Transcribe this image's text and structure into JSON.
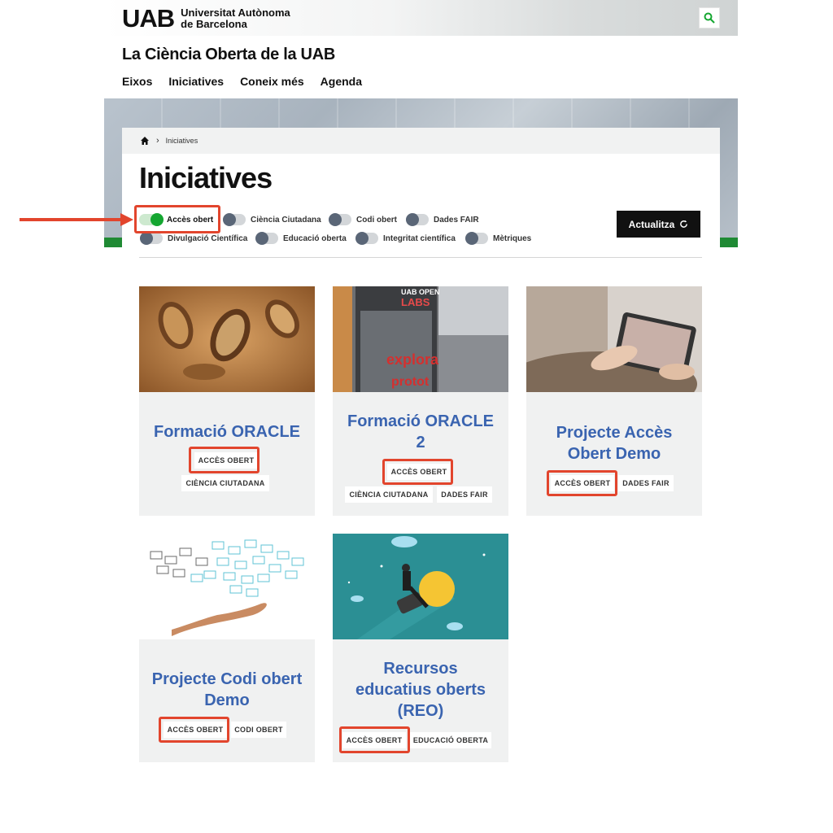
{
  "header": {
    "logo_mark": "UAB",
    "logo_line1": "Universitat Autònoma",
    "logo_line2": "de Barcelona",
    "site_title": "La Ciència Oberta de la UAB",
    "nav": [
      "Eixos",
      "Iniciatives",
      "Coneix més",
      "Agenda"
    ]
  },
  "breadcrumb": {
    "current": "Iniciatives"
  },
  "page_title": "Iniciatives",
  "filters": [
    {
      "label": "Accès obert",
      "on": true
    },
    {
      "label": "Ciència Ciutadana",
      "on": false
    },
    {
      "label": "Codi obert",
      "on": false
    },
    {
      "label": "Dades FAIR",
      "on": false
    },
    {
      "label": "Divulgació Científica",
      "on": false
    },
    {
      "label": "Educació oberta",
      "on": false
    },
    {
      "label": "Integritat científica",
      "on": false
    },
    {
      "label": "Mètriques",
      "on": false
    }
  ],
  "update_button": "Actualitza",
  "cards": [
    {
      "title_lines": [
        "Formació ORACLE"
      ],
      "tags": [
        "ACCÈS OBERT",
        "CIÈNCIA CIUTADANA"
      ],
      "image": "fossils-photo"
    },
    {
      "title_lines": [
        "Formació ORACLE",
        "2"
      ],
      "tags": [
        "ACCÈS OBERT",
        "CIÈNCIA CIUTADANA",
        "DADES FAIR"
      ],
      "image": "open-labs-photo",
      "image_text": [
        "UAB OPEN",
        "LABS",
        "explora",
        "protot"
      ]
    },
    {
      "title_lines": [
        "Projecte Accès",
        "Obert Demo"
      ],
      "tags": [
        "ACCÈS OBERT",
        "DADES FAIR"
      ],
      "image": "tablet-photo"
    },
    {
      "title_lines": [
        "Projecte Codi obert",
        "Demo"
      ],
      "tags": [
        "ACCÈS OBERT",
        "CODI OBERT"
      ],
      "image": "envelopes-hand-illustration"
    },
    {
      "title_lines": [
        "Recursos",
        "educatius oberts",
        "(REO)"
      ],
      "tags": [
        "ACCÈS OBERT",
        "EDUCACIÓ OBERTA"
      ],
      "image": "lightbulb-rocket-illustration"
    }
  ],
  "colors": {
    "accent_green": "#14a630",
    "title_blue": "#3a64b0",
    "highlight_red": "#e2452d"
  }
}
